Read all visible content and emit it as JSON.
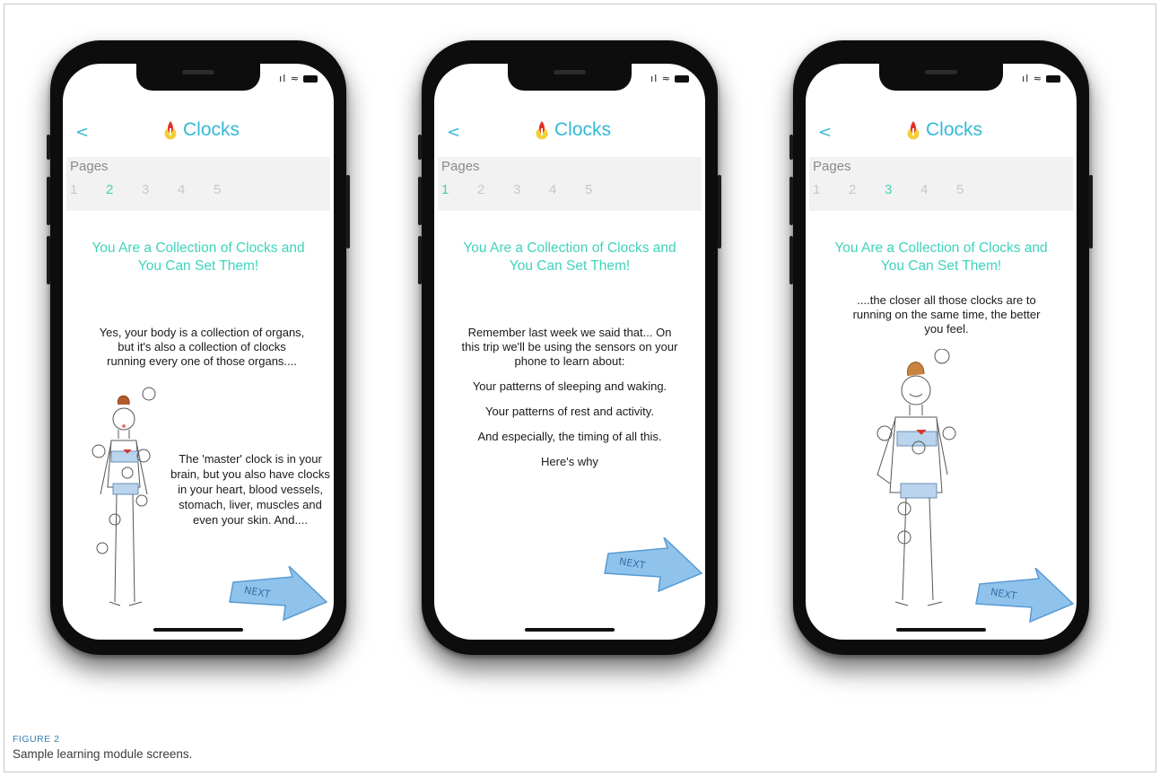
{
  "figure": {
    "label": "FIGURE 2",
    "caption": "Sample learning module screens."
  },
  "app": {
    "back": "<",
    "title": "Clocks",
    "pages_label": "Pages",
    "page_numbers": [
      "1",
      "2",
      "3",
      "4",
      "5"
    ],
    "heading_line1": "You Are a Collection of Clocks and",
    "heading_line2": "You Can Set Them!",
    "next_label": "NEXT",
    "accent_color": "#35b8d6",
    "heading_color": "#3fd3bd",
    "active_page_color": "#43d4b2"
  },
  "screens": [
    {
      "active_page": "2",
      "body": [
        "Yes, your body is a collection of organs, but it's also a collection of clocks running every one of those organs....",
        "The 'master' clock is in your brain, but you also have clocks in your heart, blood vessels, stomach, liver, muscles and even your skin. And...."
      ]
    },
    {
      "active_page": "1",
      "body": [
        "Remember last week we said that... On this trip we'll be using the sensors on your phone to learn about:",
        "Your patterns of sleeping and waking.",
        "Your patterns of rest and activity.",
        "And especially, the timing of all this.",
        "Here's why"
      ]
    },
    {
      "active_page": "3",
      "body": [
        "....the closer all those clocks are to running on the same time, the better you feel."
      ]
    }
  ]
}
